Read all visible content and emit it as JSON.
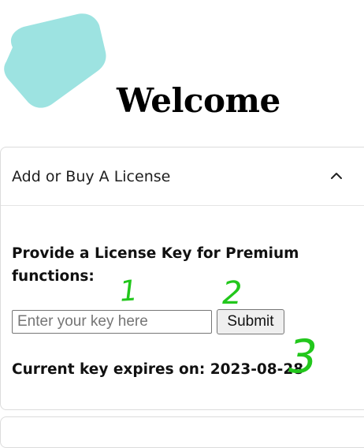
{
  "brand": {
    "logo_color": "#9de3e1"
  },
  "page": {
    "title": "Welcome"
  },
  "license_panel": {
    "header": "Add or Buy A License",
    "chevron_icon": "chevron-up-icon",
    "prompt": "Provide a License Key for Premium functions:",
    "key_input": {
      "placeholder": "Enter your key here",
      "value": ""
    },
    "submit_label": "Submit",
    "expiry_text": "Current key expires on: 2023-08-28"
  },
  "annotations": {
    "marker_1": "1",
    "marker_2": "2",
    "marker_3": "3",
    "marker_color": "#22c71c"
  }
}
